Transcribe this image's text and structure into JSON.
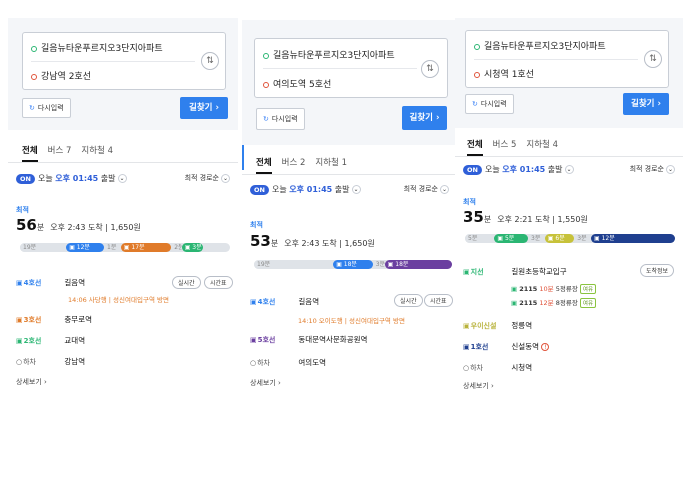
{
  "panels": [
    {
      "origin": "길음뉴타운푸르지오3단지아파트",
      "destination": "강남역 2호선",
      "reset_label": "다시입력",
      "find_label": "길찾기",
      "tabs": [
        "전체",
        "버스 7",
        "지하철 4"
      ],
      "depart": {
        "on": "ON",
        "text_prefix": "오늘",
        "time": "오후 01:45",
        "suffix": "출발"
      },
      "sort_label": "최적 경로순",
      "best_label": "최적",
      "duration_num": "56",
      "duration_unit": "분",
      "arrival": "오후 2:43 도착",
      "fare": "1,650원",
      "segments": [
        {
          "label": "19분",
          "color": "#dfe3e8",
          "kind": "walk",
          "share": 0.22
        },
        {
          "label": "12분",
          "color": "#2f80ed",
          "kind": "bus",
          "share": 0.18
        },
        {
          "label": "1분",
          "color": "#dfe3e8",
          "kind": "walk",
          "share": 0.08
        },
        {
          "label": "17분",
          "color": "#e07b2a",
          "kind": "subway",
          "share": 0.24
        },
        {
          "label": "2분",
          "color": "#dfe3e8",
          "kind": "walk",
          "share": 0.05
        },
        {
          "label": "3분",
          "color": "#2bb673",
          "kind": "subway",
          "share": 0.1
        }
      ],
      "steps": [
        {
          "line": "4호선",
          "color": "#2f80ed",
          "station": "길음역",
          "pills": [
            "실시간",
            "시간표"
          ],
          "detail": "14:06 사당행 | 성신여대입구역 방면"
        },
        {
          "line": "3호선",
          "color": "#e07b2a",
          "station": "충무로역"
        },
        {
          "line": "2호선",
          "color": "#2bb673",
          "station": "교대역"
        },
        {
          "line": "하차",
          "color": "#555555",
          "station": "강남역"
        }
      ],
      "more_label": "상세보기"
    },
    {
      "origin": "길음뉴타운푸르지오3단지아파트",
      "destination": "여의도역 5호선",
      "reset_label": "다시입력",
      "find_label": "길찾기",
      "tabs": [
        "전체",
        "버스 2",
        "지하철 1"
      ],
      "depart": {
        "on": "ON",
        "text_prefix": "오늘",
        "time": "오후 01:45",
        "suffix": "출발"
      },
      "sort_label": "최적 경로순",
      "best_label": "최적",
      "duration_num": "53",
      "duration_unit": "분",
      "arrival": "오후 2:43 도착",
      "fare": "1,650원",
      "segments": [
        {
          "label": "19분",
          "color": "#dfe3e8",
          "kind": "walk",
          "share": 0.4
        },
        {
          "label": "18분",
          "color": "#2f80ed",
          "kind": "subway",
          "share": 0.2
        },
        {
          "label": "3분",
          "color": "#dfe3e8",
          "kind": "walk",
          "share": 0.06
        },
        {
          "label": "18분",
          "color": "#6b3fa0",
          "kind": "subway",
          "share": 0.34
        }
      ],
      "steps": [
        {
          "line": "4호선",
          "color": "#2f80ed",
          "station": "길음역",
          "pills": [
            "실시간",
            "시간표"
          ],
          "detail": "14:10 오이도행 | 성신여대입구역 방면"
        },
        {
          "line": "5호선",
          "color": "#6b3fa0",
          "station": "동대문역사문화공원역"
        },
        {
          "line": "하차",
          "color": "#555555",
          "station": "여의도역"
        }
      ],
      "more_label": "상세보기"
    },
    {
      "origin": "길음뉴타운푸르지오3단지아파트",
      "destination": "시청역 1호선",
      "reset_label": "다시입력",
      "find_label": "길찾기",
      "tabs": [
        "전체",
        "버스 5",
        "지하철 4"
      ],
      "depart": {
        "on": "ON",
        "text_prefix": "오늘",
        "time": "오후 01:45",
        "suffix": "출발"
      },
      "sort_label": "최적 경로순",
      "best_label": "최적",
      "duration_num": "35",
      "duration_unit": "분",
      "arrival": "오후 2:21 도착",
      "fare": "1,550원",
      "segments": [
        {
          "label": "5분",
          "color": "#dfe3e8",
          "kind": "walk",
          "share": 0.14
        },
        {
          "label": "5분",
          "color": "#2bb673",
          "kind": "bus",
          "share": 0.16
        },
        {
          "label": "3분",
          "color": "#dfe3e8",
          "kind": "walk",
          "share": 0.08
        },
        {
          "label": "6분",
          "color": "#c7c23a",
          "kind": "subway",
          "share": 0.14
        },
        {
          "label": "3분",
          "color": "#dfe3e8",
          "kind": "walk",
          "share": 0.08
        },
        {
          "label": "12분",
          "color": "#1f3f8f",
          "kind": "subway",
          "share": 0.4
        }
      ],
      "steps": [
        {
          "line": "지선",
          "color": "#2bb673",
          "station": "길원초등학교입구",
          "pills": [
            "도착정보"
          ],
          "buses": [
            {
              "num": "2115",
              "mins": "10분",
              "stops": "5정류장",
              "tag": "여유"
            },
            {
              "num": "2115",
              "mins": "12분",
              "stops": "8정류장",
              "tag": "여유"
            }
          ]
        },
        {
          "line": "우이신설",
          "color": "#b8b23a",
          "station": "정릉역"
        },
        {
          "line": "1호선",
          "color": "#1f3f8f",
          "station": "신설동역",
          "warn": "!"
        },
        {
          "line": "하차",
          "color": "#555555",
          "station": "시청역"
        }
      ],
      "more_label": "상세보기"
    }
  ]
}
